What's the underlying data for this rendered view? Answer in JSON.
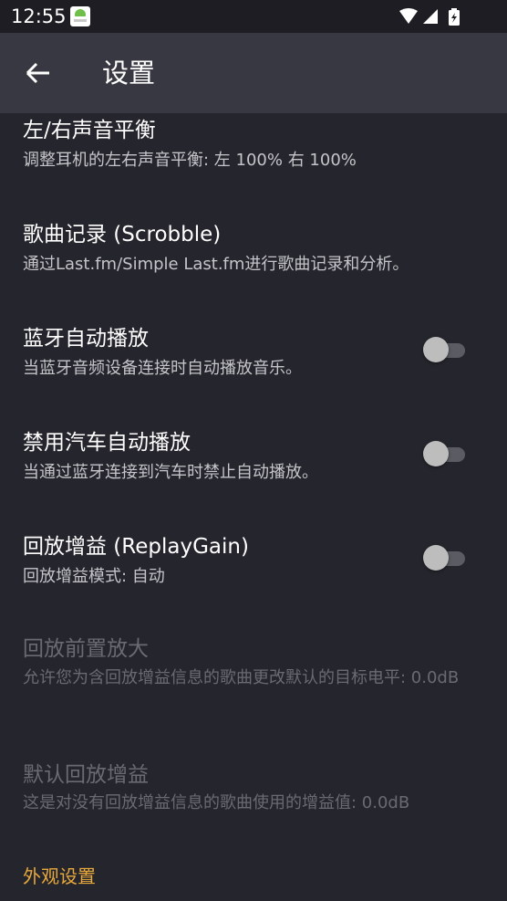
{
  "status_bar": {
    "time": "12:55",
    "icons": [
      "app-notification-icon",
      "wifi-icon",
      "signal-icon",
      "battery-charging-icon"
    ]
  },
  "app_bar": {
    "title": "设置",
    "back_icon": "arrow-back-icon"
  },
  "preferences": [
    {
      "title": "左/右声音平衡",
      "summary": "调整耳机的左右声音平衡: 左 100% 右 100%"
    },
    {
      "title": "歌曲记录 (Scrobble)",
      "summary": "通过Last.fm/Simple Last.fm进行歌曲记录和分析。"
    },
    {
      "title": "蓝牙自动播放",
      "summary": "当蓝牙音频设备连接时自动播放音乐。",
      "switch_on": false
    },
    {
      "title": "禁用汽车自动播放",
      "summary": "当通过蓝牙连接到汽车时禁止自动播放。",
      "switch_on": false
    },
    {
      "title": "回放增益 (ReplayGain)",
      "summary": "回放增益模式: 自动",
      "switch_on": false
    },
    {
      "title": "回放前置放大",
      "summary": "允许您为含回放增益信息的歌曲更改默认的目标电平: 0.0dB",
      "enabled": false
    },
    {
      "title": "默认回放增益",
      "summary": "这是对没有回放增益信息的歌曲使用的增益值: 0.0dB",
      "enabled": false
    }
  ],
  "category": {
    "title": "外观设置"
  },
  "colors": {
    "background": "#25252d",
    "app_bar": "#383843",
    "status_bar": "#1d1d23",
    "accent": "#e8a93c"
  }
}
